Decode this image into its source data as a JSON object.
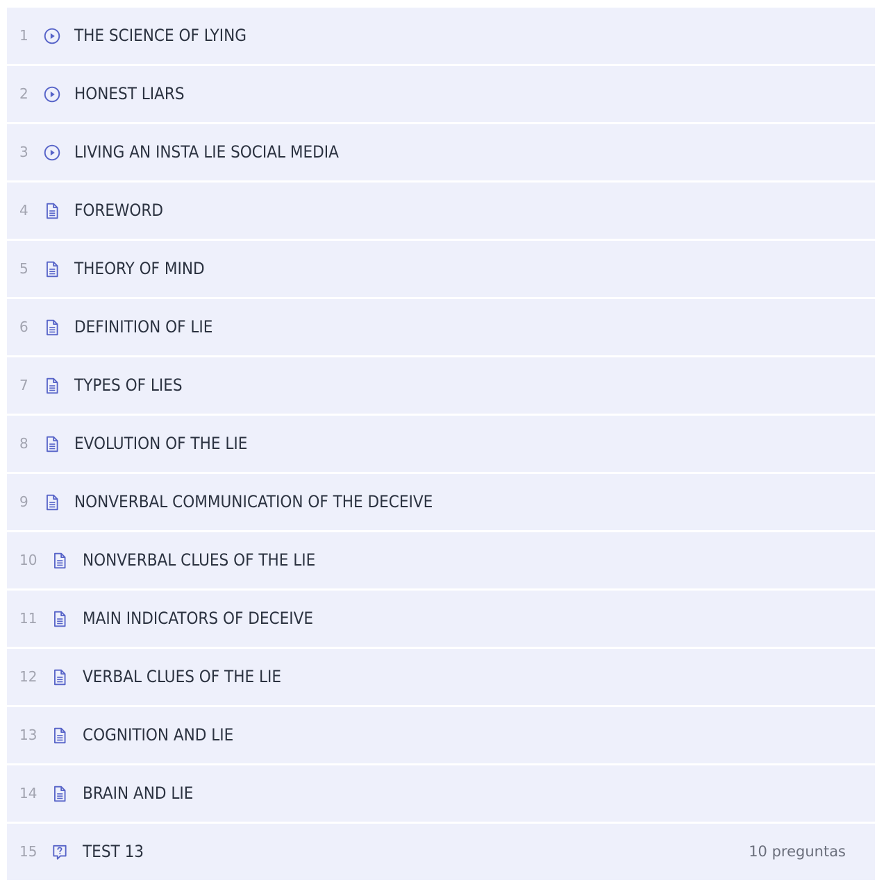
{
  "lessons": [
    {
      "num": "1",
      "title": "THE SCIENCE OF LYING",
      "icon": "play-circle-icon"
    },
    {
      "num": "2",
      "title": "HONEST LIARS",
      "icon": "play-circle-icon"
    },
    {
      "num": "3",
      "title": "LIVING AN INSTA LIE SOCIAL MEDIA",
      "icon": "play-circle-icon"
    },
    {
      "num": "4",
      "title": "FOREWORD",
      "icon": "document-icon"
    },
    {
      "num": "5",
      "title": "THEORY OF MIND",
      "icon": "document-icon"
    },
    {
      "num": "6",
      "title": "DEFINITION OF LIE",
      "icon": "document-icon"
    },
    {
      "num": "7",
      "title": "TYPES OF LIES",
      "icon": "document-icon"
    },
    {
      "num": "8",
      "title": "EVOLUTION OF THE LIE",
      "icon": "document-icon"
    },
    {
      "num": "9",
      "title": "NONVERBAL COMMUNICATION OF THE DECEIVE",
      "icon": "document-icon"
    },
    {
      "num": "10",
      "title": "NONVERBAL CLUES OF THE LIE",
      "icon": "document-icon"
    },
    {
      "num": "11",
      "title": "MAIN INDICATORS OF DECEIVE",
      "icon": "document-icon"
    },
    {
      "num": "12",
      "title": "VERBAL CLUES OF THE LIE",
      "icon": "document-icon"
    },
    {
      "num": "13",
      "title": "COGNITION AND LIE",
      "icon": "document-icon"
    },
    {
      "num": "14",
      "title": "BRAIN AND LIE",
      "icon": "document-icon"
    },
    {
      "num": "15",
      "title": "TEST 13",
      "icon": "quiz-icon",
      "meta": "10 preguntas"
    }
  ],
  "colors": {
    "row_background": "#eef0fb",
    "icon_accent": "#5663c8",
    "number_text": "#a2a4b0",
    "title_text": "#2b3240",
    "meta_text": "#6b6f7c"
  }
}
